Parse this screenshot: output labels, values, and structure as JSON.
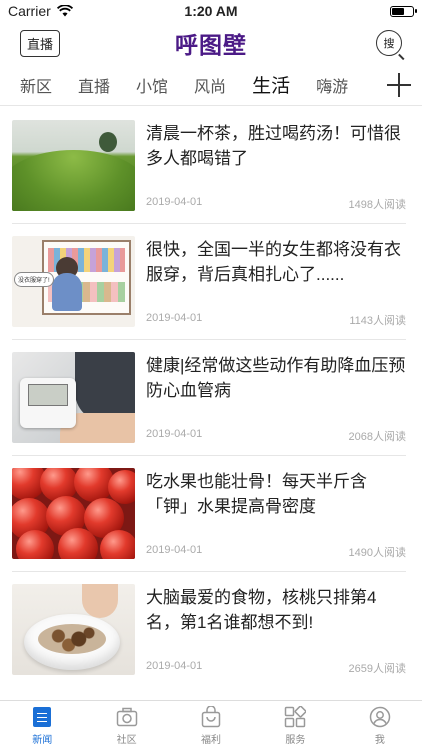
{
  "status_bar": {
    "carrier": "Carrier",
    "time": "1:20 AM"
  },
  "header": {
    "live_label": "直播",
    "logo": "呼图壁",
    "search_label": "搜"
  },
  "tabs": [
    {
      "label": "新区",
      "active": false
    },
    {
      "label": "直播",
      "active": false
    },
    {
      "label": "小馆",
      "active": false
    },
    {
      "label": "风尚",
      "active": false
    },
    {
      "label": "生活",
      "active": true
    },
    {
      "label": "嗨游",
      "active": false
    }
  ],
  "articles": [
    {
      "title": "清晨一杯茶，胜过喝药汤！可惜很多人都喝错了",
      "date": "2019-04-01",
      "reads": "1498人阅读",
      "thumb": "tea-field"
    },
    {
      "title": "很快，全国一半的女生都将没有衣服穿，背后真相扎心了......",
      "date": "2019-04-01",
      "reads": "1143人阅读",
      "thumb": "closet-cartoon",
      "thumb_caption": "没衣服穿了!"
    },
    {
      "title": "健康|经常做这些动作有助降血压预防心血管病",
      "date": "2019-04-01",
      "reads": "2068人阅读",
      "thumb": "blood-pressure-monitor"
    },
    {
      "title": "吃水果也能壮骨！每天半斤含「钾」水果提高骨密度",
      "date": "2019-04-01",
      "reads": "1490人阅读",
      "thumb": "red-berries"
    },
    {
      "title": "大脑最爱的食物，核桃只排第4名，第1名谁都想不到!",
      "date": "2019-04-01",
      "reads": "2659人阅读",
      "thumb": "walnut-bowl"
    }
  ],
  "tabbar": [
    {
      "label": "新闻",
      "icon": "news-icon",
      "active": true
    },
    {
      "label": "社区",
      "icon": "camera-icon",
      "active": false
    },
    {
      "label": "福利",
      "icon": "gift-bag-icon",
      "active": false
    },
    {
      "label": "服务",
      "icon": "grid-icon",
      "active": false
    },
    {
      "label": "我",
      "icon": "profile-icon",
      "active": false
    }
  ],
  "colors": {
    "brand": "#4b1a86",
    "accent": "#1a6fd6"
  }
}
